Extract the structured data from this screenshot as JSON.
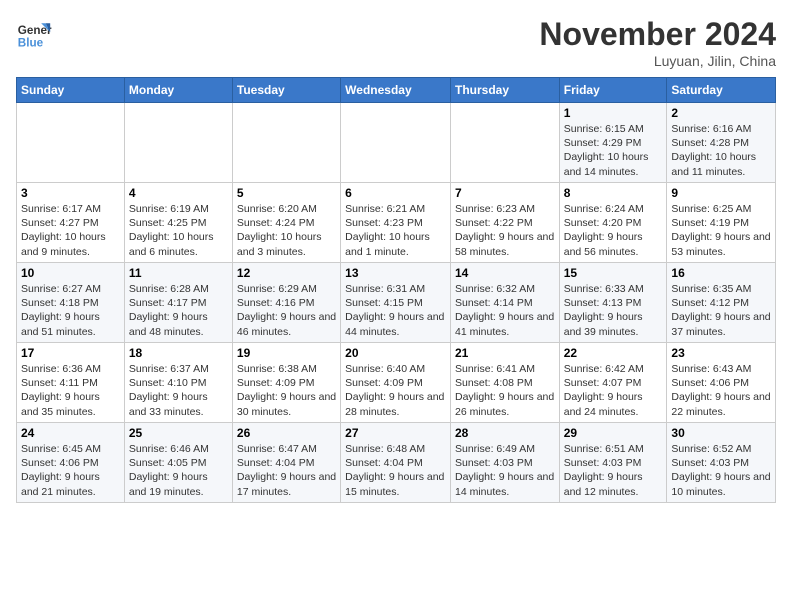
{
  "header": {
    "logo_line1": "General",
    "logo_line2": "Blue",
    "month_year": "November 2024",
    "location": "Luyuan, Jilin, China"
  },
  "days_of_week": [
    "Sunday",
    "Monday",
    "Tuesday",
    "Wednesday",
    "Thursday",
    "Friday",
    "Saturday"
  ],
  "weeks": [
    [
      {
        "day": "",
        "info": ""
      },
      {
        "day": "",
        "info": ""
      },
      {
        "day": "",
        "info": ""
      },
      {
        "day": "",
        "info": ""
      },
      {
        "day": "",
        "info": ""
      },
      {
        "day": "1",
        "info": "Sunrise: 6:15 AM\nSunset: 4:29 PM\nDaylight: 10 hours and 14 minutes."
      },
      {
        "day": "2",
        "info": "Sunrise: 6:16 AM\nSunset: 4:28 PM\nDaylight: 10 hours and 11 minutes."
      }
    ],
    [
      {
        "day": "3",
        "info": "Sunrise: 6:17 AM\nSunset: 4:27 PM\nDaylight: 10 hours and 9 minutes."
      },
      {
        "day": "4",
        "info": "Sunrise: 6:19 AM\nSunset: 4:25 PM\nDaylight: 10 hours and 6 minutes."
      },
      {
        "day": "5",
        "info": "Sunrise: 6:20 AM\nSunset: 4:24 PM\nDaylight: 10 hours and 3 minutes."
      },
      {
        "day": "6",
        "info": "Sunrise: 6:21 AM\nSunset: 4:23 PM\nDaylight: 10 hours and 1 minute."
      },
      {
        "day": "7",
        "info": "Sunrise: 6:23 AM\nSunset: 4:22 PM\nDaylight: 9 hours and 58 minutes."
      },
      {
        "day": "8",
        "info": "Sunrise: 6:24 AM\nSunset: 4:20 PM\nDaylight: 9 hours and 56 minutes."
      },
      {
        "day": "9",
        "info": "Sunrise: 6:25 AM\nSunset: 4:19 PM\nDaylight: 9 hours and 53 minutes."
      }
    ],
    [
      {
        "day": "10",
        "info": "Sunrise: 6:27 AM\nSunset: 4:18 PM\nDaylight: 9 hours and 51 minutes."
      },
      {
        "day": "11",
        "info": "Sunrise: 6:28 AM\nSunset: 4:17 PM\nDaylight: 9 hours and 48 minutes."
      },
      {
        "day": "12",
        "info": "Sunrise: 6:29 AM\nSunset: 4:16 PM\nDaylight: 9 hours and 46 minutes."
      },
      {
        "day": "13",
        "info": "Sunrise: 6:31 AM\nSunset: 4:15 PM\nDaylight: 9 hours and 44 minutes."
      },
      {
        "day": "14",
        "info": "Sunrise: 6:32 AM\nSunset: 4:14 PM\nDaylight: 9 hours and 41 minutes."
      },
      {
        "day": "15",
        "info": "Sunrise: 6:33 AM\nSunset: 4:13 PM\nDaylight: 9 hours and 39 minutes."
      },
      {
        "day": "16",
        "info": "Sunrise: 6:35 AM\nSunset: 4:12 PM\nDaylight: 9 hours and 37 minutes."
      }
    ],
    [
      {
        "day": "17",
        "info": "Sunrise: 6:36 AM\nSunset: 4:11 PM\nDaylight: 9 hours and 35 minutes."
      },
      {
        "day": "18",
        "info": "Sunrise: 6:37 AM\nSunset: 4:10 PM\nDaylight: 9 hours and 33 minutes."
      },
      {
        "day": "19",
        "info": "Sunrise: 6:38 AM\nSunset: 4:09 PM\nDaylight: 9 hours and 30 minutes."
      },
      {
        "day": "20",
        "info": "Sunrise: 6:40 AM\nSunset: 4:09 PM\nDaylight: 9 hours and 28 minutes."
      },
      {
        "day": "21",
        "info": "Sunrise: 6:41 AM\nSunset: 4:08 PM\nDaylight: 9 hours and 26 minutes."
      },
      {
        "day": "22",
        "info": "Sunrise: 6:42 AM\nSunset: 4:07 PM\nDaylight: 9 hours and 24 minutes."
      },
      {
        "day": "23",
        "info": "Sunrise: 6:43 AM\nSunset: 4:06 PM\nDaylight: 9 hours and 22 minutes."
      }
    ],
    [
      {
        "day": "24",
        "info": "Sunrise: 6:45 AM\nSunset: 4:06 PM\nDaylight: 9 hours and 21 minutes."
      },
      {
        "day": "25",
        "info": "Sunrise: 6:46 AM\nSunset: 4:05 PM\nDaylight: 9 hours and 19 minutes."
      },
      {
        "day": "26",
        "info": "Sunrise: 6:47 AM\nSunset: 4:04 PM\nDaylight: 9 hours and 17 minutes."
      },
      {
        "day": "27",
        "info": "Sunrise: 6:48 AM\nSunset: 4:04 PM\nDaylight: 9 hours and 15 minutes."
      },
      {
        "day": "28",
        "info": "Sunrise: 6:49 AM\nSunset: 4:03 PM\nDaylight: 9 hours and 14 minutes."
      },
      {
        "day": "29",
        "info": "Sunrise: 6:51 AM\nSunset: 4:03 PM\nDaylight: 9 hours and 12 minutes."
      },
      {
        "day": "30",
        "info": "Sunrise: 6:52 AM\nSunset: 4:03 PM\nDaylight: 9 hours and 10 minutes."
      }
    ]
  ]
}
